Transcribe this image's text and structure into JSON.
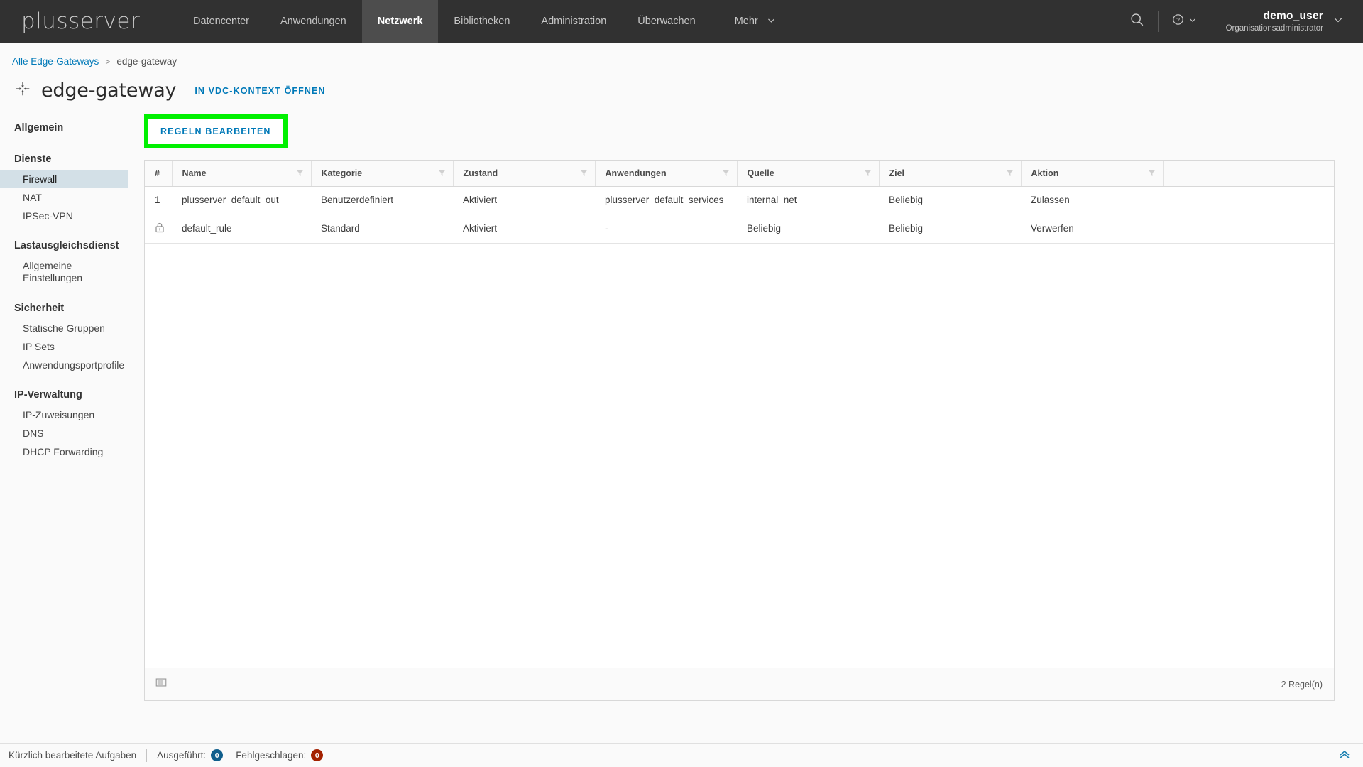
{
  "topnav": {
    "brand": "plusserver",
    "items": [
      {
        "label": "Datencenter",
        "active": false
      },
      {
        "label": "Anwendungen",
        "active": false
      },
      {
        "label": "Netzwerk",
        "active": true
      },
      {
        "label": "Bibliotheken",
        "active": false
      },
      {
        "label": "Administration",
        "active": false
      },
      {
        "label": "Überwachen",
        "active": false
      }
    ],
    "more_label": "Mehr",
    "search_icon": "search-icon",
    "help_icon": "help-icon",
    "user": {
      "name": "demo_user",
      "role": "Organisationsadministrator"
    }
  },
  "breadcrumb": {
    "root": "Alle Edge-Gateways",
    "separator": ">",
    "current": "edge-gateway"
  },
  "page": {
    "title": "edge-gateway",
    "title_icon": "move-arrows-icon",
    "context_link": "IN VDC-KONTEXT ÖFFNEN"
  },
  "sidebar": {
    "groups": [
      {
        "heading": "Allgemein",
        "heading_is_item": true,
        "items": []
      },
      {
        "heading": "Dienste",
        "items": [
          {
            "label": "Firewall",
            "active": true
          },
          {
            "label": "NAT",
            "active": false
          },
          {
            "label": "IPSec-VPN",
            "active": false
          }
        ]
      },
      {
        "heading": "Lastausgleichsdienst",
        "items": [
          {
            "label": "Allgemeine Einstellungen",
            "active": false,
            "twoline": true
          }
        ]
      },
      {
        "heading": "Sicherheit",
        "items": [
          {
            "label": "Statische Gruppen",
            "active": false
          },
          {
            "label": "IP Sets",
            "active": false
          },
          {
            "label": "Anwendungsportprofile",
            "active": false
          }
        ]
      },
      {
        "heading": "IP-Verwaltung",
        "items": [
          {
            "label": "IP-Zuweisungen",
            "active": false
          },
          {
            "label": "DNS",
            "active": false
          },
          {
            "label": "DHCP Forwarding",
            "active": false
          }
        ]
      }
    ]
  },
  "toolbar": {
    "edit_rules_label": "REGELN BEARBEITEN",
    "highlight_color": "#00f000"
  },
  "table": {
    "columns": [
      {
        "label": "#",
        "filter": false,
        "cls": "col-num"
      },
      {
        "label": "Name",
        "filter": true,
        "cls": "col-name"
      },
      {
        "label": "Kategorie",
        "filter": true,
        "cls": "col-kat"
      },
      {
        "label": "Zustand",
        "filter": true,
        "cls": "col-zus"
      },
      {
        "label": "Anwendungen",
        "filter": true,
        "cls": "col-anw"
      },
      {
        "label": "Quelle",
        "filter": true,
        "cls": "col-que"
      },
      {
        "label": "Ziel",
        "filter": true,
        "cls": "col-ziel"
      },
      {
        "label": "Aktion",
        "filter": true,
        "cls": "col-akt"
      },
      {
        "label": "",
        "filter": false,
        "cls": "col-pad"
      }
    ],
    "rows": [
      {
        "num": "1",
        "locked": false,
        "name": "plusserver_default_out",
        "kategorie": "Benutzerdefiniert",
        "zustand": "Aktiviert",
        "anwendungen": "plusserver_default_services",
        "quelle": "internal_net",
        "ziel": "Beliebig",
        "aktion": "Zulassen"
      },
      {
        "num": "",
        "locked": true,
        "lock_icon": "lock-icon",
        "name": "default_rule",
        "kategorie": "Standard",
        "zustand": "Aktiviert",
        "anwendungen": "-",
        "quelle": "Beliebig",
        "ziel": "Beliebig",
        "aktion": "Verwerfen"
      }
    ],
    "footer": {
      "layout_icon": "column-layout-icon",
      "count_label": "2 Regel(n)"
    }
  },
  "statusbar": {
    "tasks_label": "Kürzlich bearbeitete Aufgaben",
    "running_label": "Ausgeführt:",
    "running_count": "0",
    "failed_label": "Fehlgeschlagen:",
    "failed_count": "0",
    "expand_icon": "double-chevron-up-icon"
  }
}
